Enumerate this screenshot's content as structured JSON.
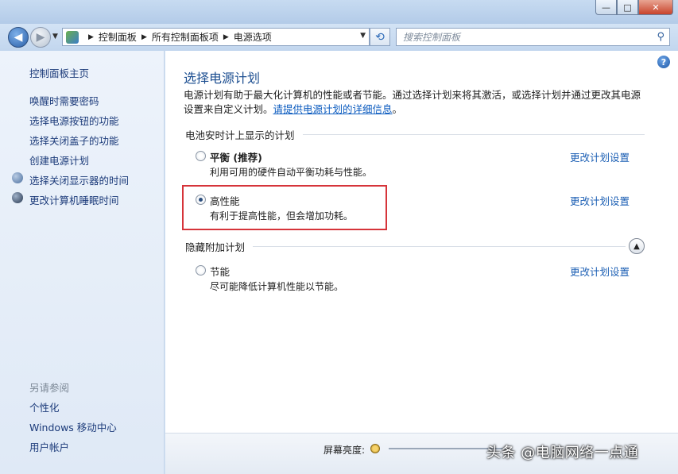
{
  "window": {
    "controls": {
      "minimize": "—",
      "maximize": "□",
      "close": "✕"
    }
  },
  "nav": {
    "back_glyph": "◀",
    "forward_glyph": "▶",
    "breadcrumb": [
      "控制面板",
      "所有控制面板项",
      "电源选项"
    ],
    "search_placeholder": "搜索控制面板"
  },
  "sidebar": {
    "home": "控制面板主页",
    "items": [
      {
        "label": "唤醒时需要密码",
        "icon": ""
      },
      {
        "label": "选择电源按钮的功能",
        "icon": ""
      },
      {
        "label": "选择关闭盖子的功能",
        "icon": ""
      },
      {
        "label": "创建电源计划",
        "icon": ""
      },
      {
        "label": "选择关闭显示器的时间",
        "icon": "monitor-icon"
      },
      {
        "label": "更改计算机睡眠时间",
        "icon": "moon-icon"
      }
    ],
    "see_also_title": "另请参阅",
    "see_also": [
      "个性化",
      "Windows 移动中心",
      "用户帐户"
    ]
  },
  "main": {
    "title": "选择电源计划",
    "description": "电源计划有助于最大化计算机的性能或者节能。通过选择计划来将其激活，或选择计划并通过更改其电源设置来自定义计划。",
    "detail_link": "请提供电源计划的详细信息",
    "description_end": "。",
    "battery_section": "电池安时计上显示的计划",
    "hidden_section": "隐藏附加计划",
    "change_link": "更改计划设置",
    "plans": [
      {
        "name": "平衡 (推荐)",
        "desc": "利用可用的硬件自动平衡功耗与性能。",
        "selected": false
      },
      {
        "name": "高性能",
        "desc": "有利于提高性能，但会增加功耗。",
        "selected": true
      },
      {
        "name": "节能",
        "desc": "尽可能降低计算机性能以节能。",
        "selected": false
      }
    ]
  },
  "bottom": {
    "brightness_label": "屏幕亮度:"
  },
  "watermark": "头条 @电脑网络一点通",
  "colors": {
    "link": "#1c5fb4",
    "title": "#1d4f91",
    "highlight": "#d6343a"
  }
}
